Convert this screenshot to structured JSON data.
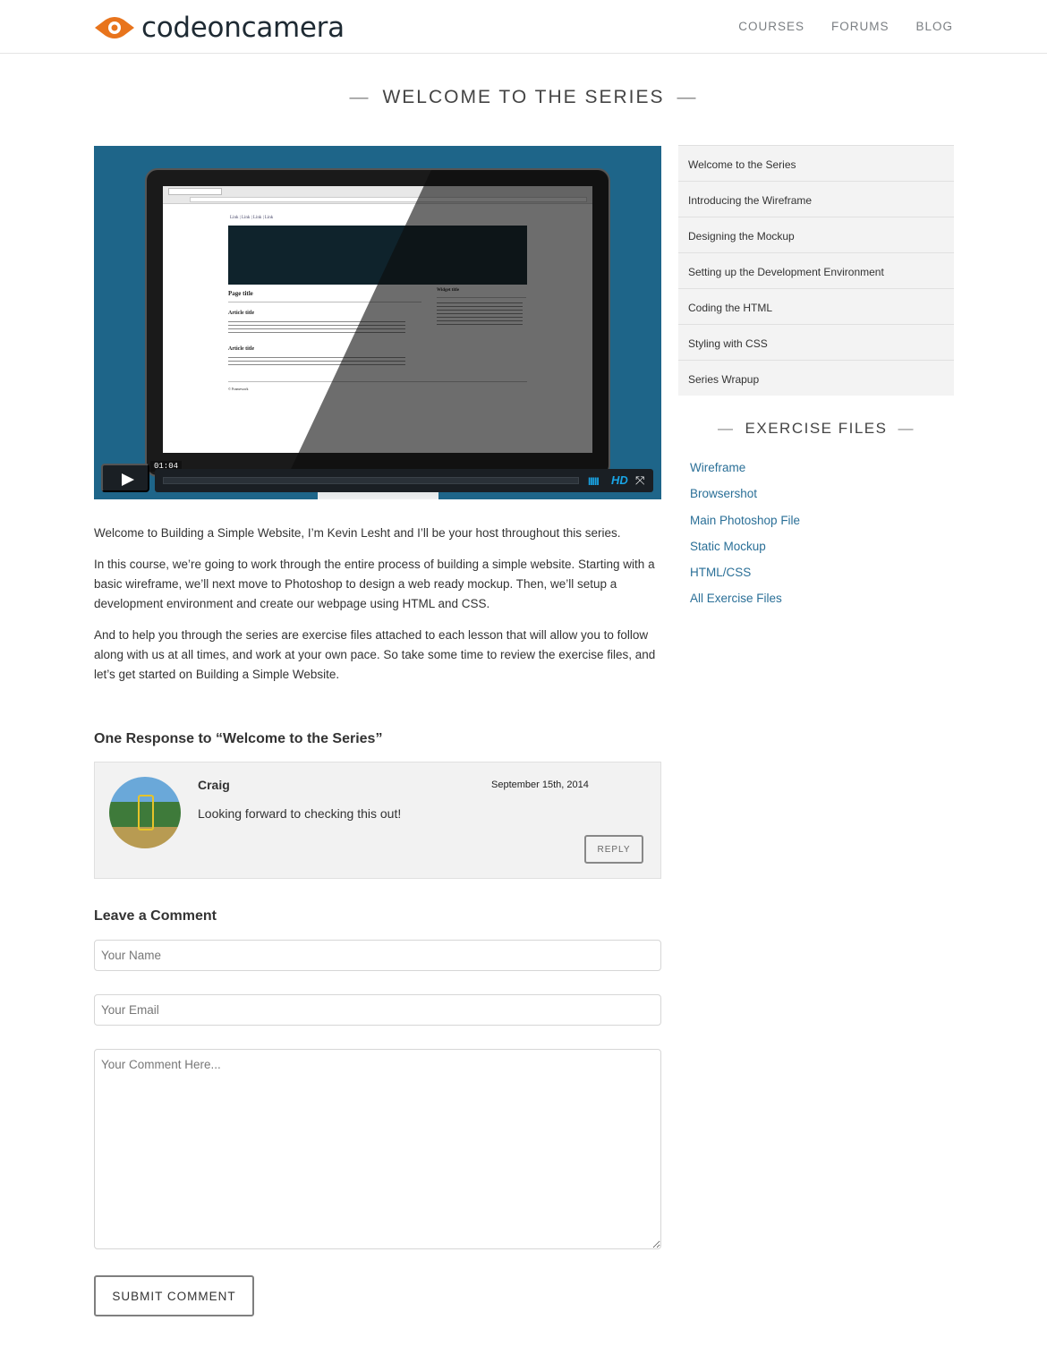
{
  "header": {
    "logo_text": "codeoncamera",
    "nav": [
      "COURSES",
      "FORUMS",
      "BLOG"
    ]
  },
  "page_title": "WELCOME TO THE SERIES",
  "video": {
    "time": "01:04",
    "hd_label": "HD",
    "screen": {
      "links": "Link | Link | Link | Link",
      "page_title": "Page title",
      "article_title_1": "Article title",
      "article_title_2": "Article title",
      "widget_title": "Widget title",
      "footer": "© Framework"
    }
  },
  "content": {
    "paragraphs": [
      "Welcome to Building a Simple Website, I’m Kevin Lesht and I’ll be your host throughout this series.",
      "In this course, we’re going to work through the entire process of building a simple website. Starting with a basic wireframe, we’ll next move to Photoshop to design a web ready mockup. Then, we’ll setup a development environment and create our webpage using HTML and CSS.",
      "And to help you through the series are exercise files attached to each lesson that will allow you to follow along with us at all times, and work at your own pace. So take some time to review the exercise files, and let’s get started on Building a Simple Website."
    ]
  },
  "comments": {
    "title": "One Response to “Welcome to the Series”",
    "items": [
      {
        "author": "Craig",
        "date": "September 15th, 2014",
        "text": "Looking forward to checking this out!",
        "reply_label": "REPLY"
      }
    ]
  },
  "form": {
    "title": "Leave a Comment",
    "name_placeholder": "Your Name",
    "email_placeholder": "Your Email",
    "comment_placeholder": "Your Comment Here...",
    "submit_label": "SUBMIT COMMENT"
  },
  "sidebar": {
    "lessons": [
      "Welcome to the Series",
      "Introducing the Wireframe",
      "Designing the Mockup",
      "Setting up the Development Environment",
      "Coding the HTML",
      "Styling with CSS",
      "Series Wrapup"
    ],
    "exercise_title": "EXERCISE FILES",
    "exercise_files": [
      "Wireframe",
      "Browsershot",
      "Main Photoshop File",
      "Static Mockup",
      "HTML/CSS",
      "All Exercise Files"
    ]
  },
  "colors": {
    "accent_orange": "#e8741c",
    "video_bg": "#1e6589",
    "link_blue": "#2a6f97",
    "player_blue": "#19a5e6"
  },
  "icons": [
    "logo-eye-icon",
    "play-icon",
    "volume-icon",
    "fullscreen-icon",
    "resize-handle-icon"
  ]
}
